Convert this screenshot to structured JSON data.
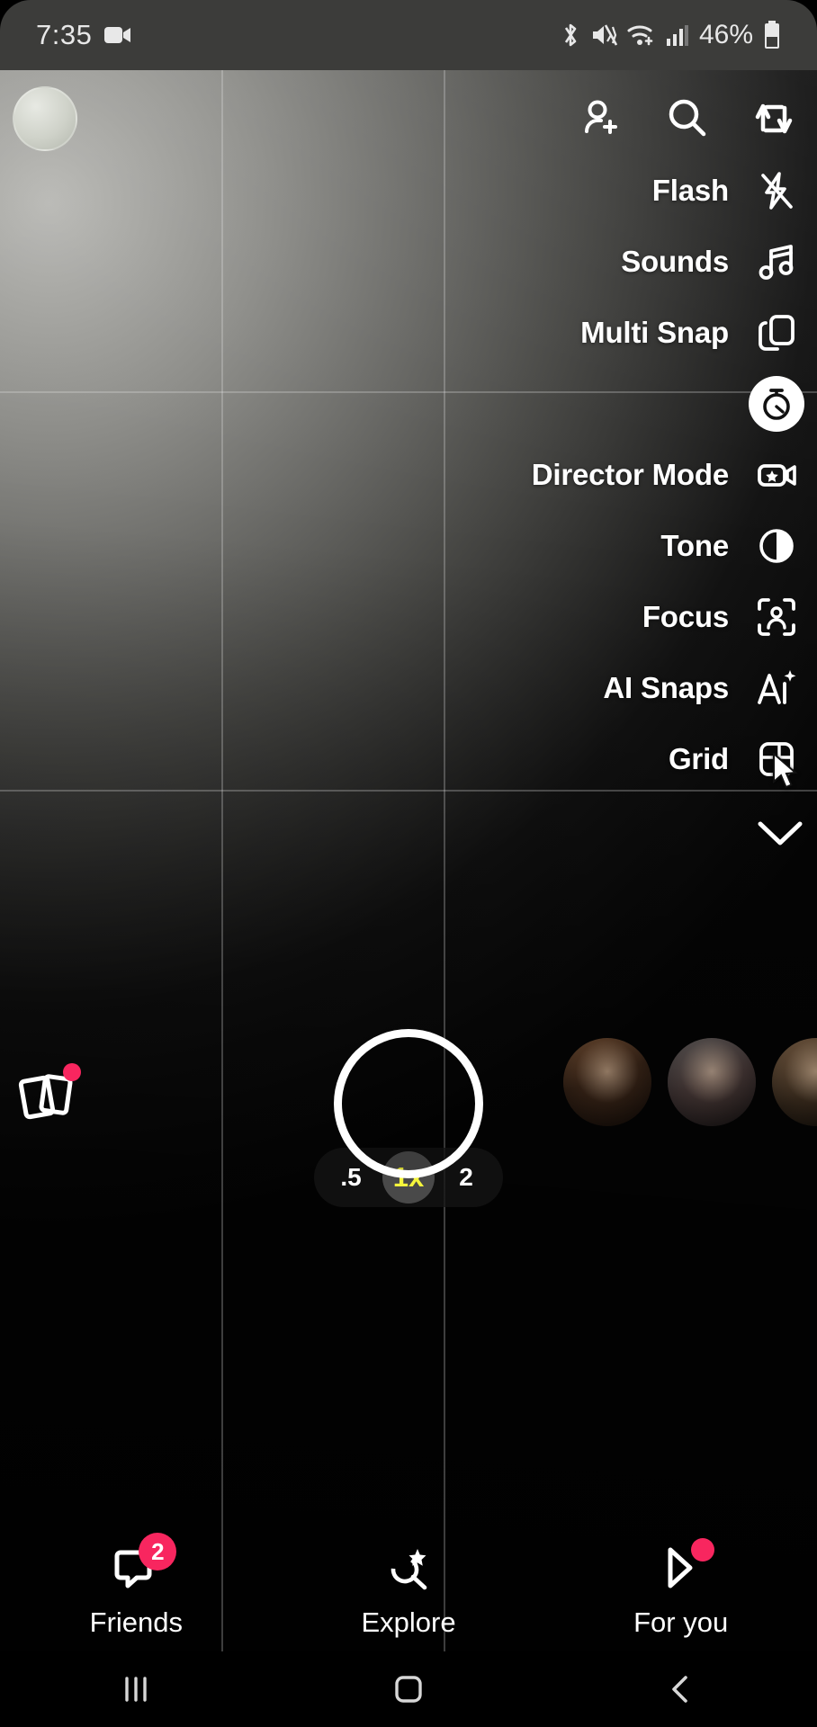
{
  "status_bar": {
    "time": "7:35",
    "battery_percent": "46%",
    "icons": [
      "video-recording-icon",
      "bluetooth-icon",
      "mute-vibrate-icon",
      "wifi-icon",
      "cellular-signal-icon",
      "battery-icon"
    ]
  },
  "top_actions": [
    {
      "name": "add-friend-icon",
      "label": "Add Friend"
    },
    {
      "name": "search-icon",
      "label": "Search"
    },
    {
      "name": "flip-camera-icon",
      "label": "Flip Camera"
    }
  ],
  "tool_menu": {
    "items": [
      {
        "label": "Flash",
        "icon": "flash-off-icon",
        "active": false
      },
      {
        "label": "Sounds",
        "icon": "music-note-icon",
        "active": false
      },
      {
        "label": "Multi Snap",
        "icon": "multi-snap-icon",
        "active": false
      },
      {
        "label": "",
        "icon": "timer-icon",
        "active": true
      },
      {
        "label": "Director Mode",
        "icon": "director-mode-icon",
        "active": false
      },
      {
        "label": "Tone",
        "icon": "tone-icon",
        "active": false
      },
      {
        "label": "Focus",
        "icon": "focus-icon",
        "active": false
      },
      {
        "label": "AI Snaps",
        "icon": "ai-snaps-icon",
        "active": false
      },
      {
        "label": "Grid",
        "icon": "grid-icon",
        "active": false
      }
    ],
    "collapse_icon": "chevron-down-icon"
  },
  "zoom_control": {
    "options": [
      {
        "value": ".5",
        "selected": false
      },
      {
        "value": "1x",
        "selected": true
      },
      {
        "value": "2",
        "selected": false
      }
    ],
    "selected_color": "#f5f53c"
  },
  "capture": {
    "shutter_label": "Capture",
    "memories_label": "Memories",
    "memories_has_notification": true
  },
  "friend_strip": [
    {
      "name": "friend-avatar-1"
    },
    {
      "name": "friend-avatar-2"
    },
    {
      "name": "friend-avatar-3"
    }
  ],
  "bottom_nav": [
    {
      "label": "Friends",
      "icon": "chat-bubble-icon",
      "badge": "2",
      "badge_type": "count"
    },
    {
      "label": "Explore",
      "icon": "explore-icon",
      "badge": "",
      "badge_type": "none"
    },
    {
      "label": "For you",
      "icon": "spotlight-icon",
      "badge": "",
      "badge_type": "dot"
    }
  ],
  "system_nav": [
    {
      "name": "recents-button",
      "glyph": "|||"
    },
    {
      "name": "home-button",
      "glyph": "▢"
    },
    {
      "name": "back-button",
      "glyph": "‹"
    }
  ],
  "colors": {
    "accent_red": "#f8265f",
    "accent_yellow": "#f5f53c",
    "text_white": "#ffffff"
  }
}
